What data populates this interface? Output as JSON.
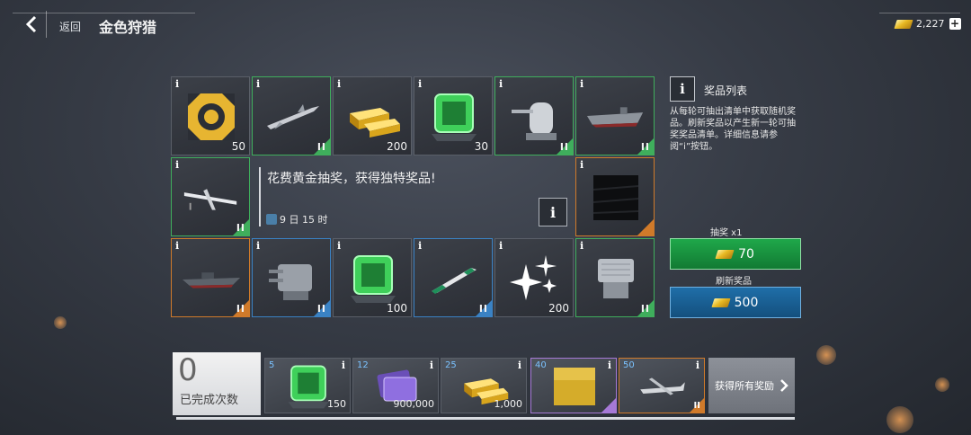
{
  "header": {
    "back_label": "返回",
    "title": "金色狩猎",
    "gold_amount": "2,227"
  },
  "grid": {
    "tiles": [
      {
        "name": "insignia",
        "qty": "50",
        "tier": "",
        "rarity": "none",
        "icon": "gold-insignia-icon"
      },
      {
        "name": "missile",
        "qty": "",
        "tier": "II",
        "rarity": "green",
        "icon": "missile-icon"
      },
      {
        "name": "gold-bars",
        "qty": "200",
        "tier": "",
        "rarity": "none",
        "icon": "gold-bars-icon"
      },
      {
        "name": "green-module",
        "qty": "30",
        "tier": "",
        "rarity": "none",
        "icon": "green-module-icon"
      },
      {
        "name": "naval-gun",
        "qty": "",
        "tier": "II",
        "rarity": "green",
        "icon": "naval-gun-icon"
      },
      {
        "name": "carrier",
        "qty": "",
        "tier": "II",
        "rarity": "green",
        "icon": "aircraft-carrier-icon"
      },
      {
        "name": "drone",
        "qty": "",
        "tier": "II",
        "rarity": "green",
        "icon": "drone-icon"
      },
      {
        "name": "camouflage",
        "qty": "",
        "tier": "",
        "rarity": "orange",
        "icon": "camouflage-icon"
      },
      {
        "name": "destroyer",
        "qty": "",
        "tier": "II",
        "rarity": "orange",
        "icon": "destroyer-icon"
      },
      {
        "name": "turret",
        "qty": "",
        "tier": "II",
        "rarity": "blue",
        "icon": "turret-icon"
      },
      {
        "name": "green-module-2",
        "qty": "100",
        "tier": "",
        "rarity": "none",
        "icon": "green-module-icon"
      },
      {
        "name": "torpedo",
        "qty": "",
        "tier": "II",
        "rarity": "blue",
        "icon": "torpedo-icon"
      },
      {
        "name": "sparkles",
        "qty": "200",
        "tier": "",
        "rarity": "none",
        "icon": "sparkle-icon"
      },
      {
        "name": "launcher",
        "qty": "",
        "tier": "II",
        "rarity": "green",
        "icon": "missile-launcher-icon"
      }
    ],
    "info_glyph": "i"
  },
  "center": {
    "headline": "花费黄金抽奖，获得独特奖品!",
    "timer": "9 日 15 时"
  },
  "prize_list": {
    "title": "奖品列表",
    "description": "从每轮可抽出清单中获取随机奖品。刷新奖品以产生新一轮可抽奖奖品清单。详细信息请参阅“i”按钮。"
  },
  "actions": {
    "draw_label": "抽奖 x1",
    "draw_cost": "70",
    "refresh_label": "刷新奖品",
    "refresh_cost": "500"
  },
  "progress": {
    "completed_count": "0",
    "completed_label": "已完成次数",
    "milestones": [
      {
        "count": "5",
        "qty": "150",
        "rarity": "none",
        "icon": "green-module-icon"
      },
      {
        "count": "12",
        "qty": "900,000",
        "rarity": "none",
        "icon": "purple-cards-icon"
      },
      {
        "count": "25",
        "qty": "1,000",
        "rarity": "none",
        "icon": "gold-bars-icon"
      },
      {
        "count": "40",
        "qty": "",
        "rarity": "purple",
        "icon": "gold-tile-icon"
      },
      {
        "count": "50",
        "qty": "",
        "tier": "II",
        "rarity": "orange",
        "icon": "seaplane-icon"
      }
    ],
    "claim_all_label": "获得所有奖励"
  },
  "colors": {
    "green": "#3fae5c",
    "blue": "#3a82c4",
    "orange": "#d07a2a",
    "purple": "#a679d6",
    "gold": "#e8b923"
  }
}
